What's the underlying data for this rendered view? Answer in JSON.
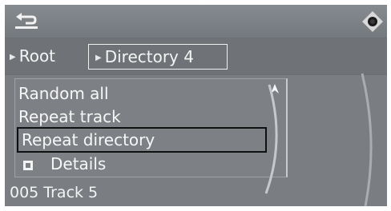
{
  "titlebar": {
    "back_icon": "back-arrow-icon",
    "nav_icon": "controller-knob-icon"
  },
  "breadcrumb": {
    "root_label": "Root",
    "directory_label": "Directory  4"
  },
  "menu": {
    "items": [
      {
        "label": "Random all"
      },
      {
        "label": "Repeat track"
      },
      {
        "label": "Repeat directory",
        "selected": true
      },
      {
        "label": "Details"
      }
    ]
  },
  "status": {
    "track": "005 Track 5"
  },
  "colors": {
    "screen_bg": "#6c7074",
    "text": "#f4f4f4",
    "highlight_border": "#101010"
  }
}
